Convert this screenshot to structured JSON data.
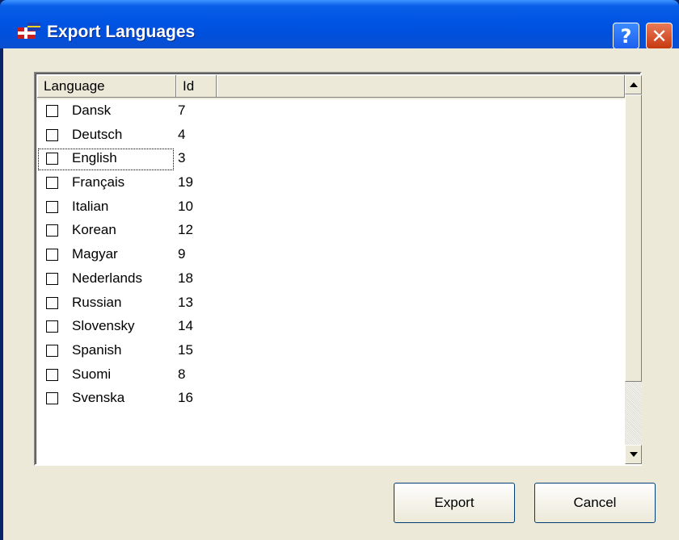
{
  "window": {
    "title": "Export Languages"
  },
  "titlebar_buttons": {
    "help": "?",
    "close": "✕"
  },
  "list": {
    "columns": [
      "Language",
      "Id"
    ],
    "rows": [
      {
        "language": "Dansk",
        "id": "7",
        "checked": false
      },
      {
        "language": "Deutsch",
        "id": "4",
        "checked": false
      },
      {
        "language": "English",
        "id": "3",
        "checked": false,
        "focused": true
      },
      {
        "language": "Français",
        "id": "19",
        "checked": false
      },
      {
        "language": "Italian",
        "id": "10",
        "checked": false
      },
      {
        "language": "Korean",
        "id": "12",
        "checked": false
      },
      {
        "language": "Magyar",
        "id": "9",
        "checked": false
      },
      {
        "language": "Nederlands",
        "id": "18",
        "checked": false
      },
      {
        "language": "Russian",
        "id": "13",
        "checked": false
      },
      {
        "language": "Slovensky",
        "id": "14",
        "checked": false
      },
      {
        "language": "Spanish",
        "id": "15",
        "checked": false
      },
      {
        "language": "Suomi",
        "id": "8",
        "checked": false
      },
      {
        "language": "Svenska",
        "id": "16",
        "checked": false
      }
    ]
  },
  "buttons": {
    "export": "Export",
    "cancel": "Cancel"
  },
  "colors": {
    "titlebar": "#0054e3",
    "face": "#ece9d8",
    "close": "#c7380f"
  }
}
